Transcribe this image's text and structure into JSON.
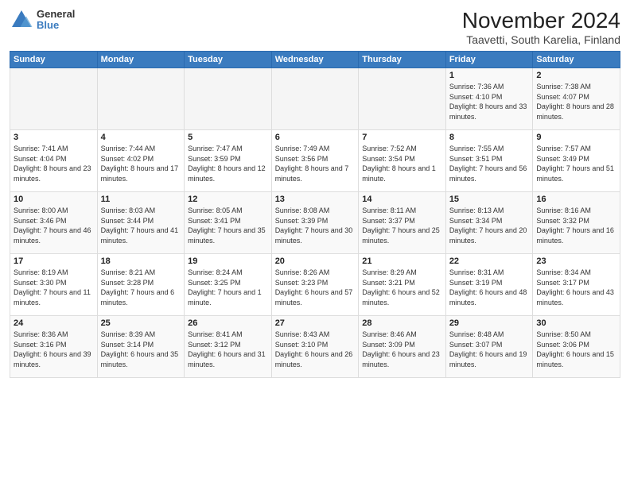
{
  "logo": {
    "general": "General",
    "blue": "Blue"
  },
  "title": "November 2024",
  "subtitle": "Taavetti, South Karelia, Finland",
  "days_of_week": [
    "Sunday",
    "Monday",
    "Tuesday",
    "Wednesday",
    "Thursday",
    "Friday",
    "Saturday"
  ],
  "weeks": [
    [
      {
        "day": "",
        "info": ""
      },
      {
        "day": "",
        "info": ""
      },
      {
        "day": "",
        "info": ""
      },
      {
        "day": "",
        "info": ""
      },
      {
        "day": "",
        "info": ""
      },
      {
        "day": "1",
        "info": "Sunrise: 7:36 AM\nSunset: 4:10 PM\nDaylight: 8 hours\nand 33 minutes."
      },
      {
        "day": "2",
        "info": "Sunrise: 7:38 AM\nSunset: 4:07 PM\nDaylight: 8 hours\nand 28 minutes."
      }
    ],
    [
      {
        "day": "3",
        "info": "Sunrise: 7:41 AM\nSunset: 4:04 PM\nDaylight: 8 hours\nand 23 minutes."
      },
      {
        "day": "4",
        "info": "Sunrise: 7:44 AM\nSunset: 4:02 PM\nDaylight: 8 hours\nand 17 minutes."
      },
      {
        "day": "5",
        "info": "Sunrise: 7:47 AM\nSunset: 3:59 PM\nDaylight: 8 hours\nand 12 minutes."
      },
      {
        "day": "6",
        "info": "Sunrise: 7:49 AM\nSunset: 3:56 PM\nDaylight: 8 hours\nand 7 minutes."
      },
      {
        "day": "7",
        "info": "Sunrise: 7:52 AM\nSunset: 3:54 PM\nDaylight: 8 hours\nand 1 minute."
      },
      {
        "day": "8",
        "info": "Sunrise: 7:55 AM\nSunset: 3:51 PM\nDaylight: 7 hours\nand 56 minutes."
      },
      {
        "day": "9",
        "info": "Sunrise: 7:57 AM\nSunset: 3:49 PM\nDaylight: 7 hours\nand 51 minutes."
      }
    ],
    [
      {
        "day": "10",
        "info": "Sunrise: 8:00 AM\nSunset: 3:46 PM\nDaylight: 7 hours\nand 46 minutes."
      },
      {
        "day": "11",
        "info": "Sunrise: 8:03 AM\nSunset: 3:44 PM\nDaylight: 7 hours\nand 41 minutes."
      },
      {
        "day": "12",
        "info": "Sunrise: 8:05 AM\nSunset: 3:41 PM\nDaylight: 7 hours\nand 35 minutes."
      },
      {
        "day": "13",
        "info": "Sunrise: 8:08 AM\nSunset: 3:39 PM\nDaylight: 7 hours\nand 30 minutes."
      },
      {
        "day": "14",
        "info": "Sunrise: 8:11 AM\nSunset: 3:37 PM\nDaylight: 7 hours\nand 25 minutes."
      },
      {
        "day": "15",
        "info": "Sunrise: 8:13 AM\nSunset: 3:34 PM\nDaylight: 7 hours\nand 20 minutes."
      },
      {
        "day": "16",
        "info": "Sunrise: 8:16 AM\nSunset: 3:32 PM\nDaylight: 7 hours\nand 16 minutes."
      }
    ],
    [
      {
        "day": "17",
        "info": "Sunrise: 8:19 AM\nSunset: 3:30 PM\nDaylight: 7 hours\nand 11 minutes."
      },
      {
        "day": "18",
        "info": "Sunrise: 8:21 AM\nSunset: 3:28 PM\nDaylight: 7 hours\nand 6 minutes."
      },
      {
        "day": "19",
        "info": "Sunrise: 8:24 AM\nSunset: 3:25 PM\nDaylight: 7 hours\nand 1 minute."
      },
      {
        "day": "20",
        "info": "Sunrise: 8:26 AM\nSunset: 3:23 PM\nDaylight: 6 hours\nand 57 minutes."
      },
      {
        "day": "21",
        "info": "Sunrise: 8:29 AM\nSunset: 3:21 PM\nDaylight: 6 hours\nand 52 minutes."
      },
      {
        "day": "22",
        "info": "Sunrise: 8:31 AM\nSunset: 3:19 PM\nDaylight: 6 hours\nand 48 minutes."
      },
      {
        "day": "23",
        "info": "Sunrise: 8:34 AM\nSunset: 3:17 PM\nDaylight: 6 hours\nand 43 minutes."
      }
    ],
    [
      {
        "day": "24",
        "info": "Sunrise: 8:36 AM\nSunset: 3:16 PM\nDaylight: 6 hours\nand 39 minutes."
      },
      {
        "day": "25",
        "info": "Sunrise: 8:39 AM\nSunset: 3:14 PM\nDaylight: 6 hours\nand 35 minutes."
      },
      {
        "day": "26",
        "info": "Sunrise: 8:41 AM\nSunset: 3:12 PM\nDaylight: 6 hours\nand 31 minutes."
      },
      {
        "day": "27",
        "info": "Sunrise: 8:43 AM\nSunset: 3:10 PM\nDaylight: 6 hours\nand 26 minutes."
      },
      {
        "day": "28",
        "info": "Sunrise: 8:46 AM\nSunset: 3:09 PM\nDaylight: 6 hours\nand 23 minutes."
      },
      {
        "day": "29",
        "info": "Sunrise: 8:48 AM\nSunset: 3:07 PM\nDaylight: 6 hours\nand 19 minutes."
      },
      {
        "day": "30",
        "info": "Sunrise: 8:50 AM\nSunset: 3:06 PM\nDaylight: 6 hours\nand 15 minutes."
      }
    ]
  ]
}
